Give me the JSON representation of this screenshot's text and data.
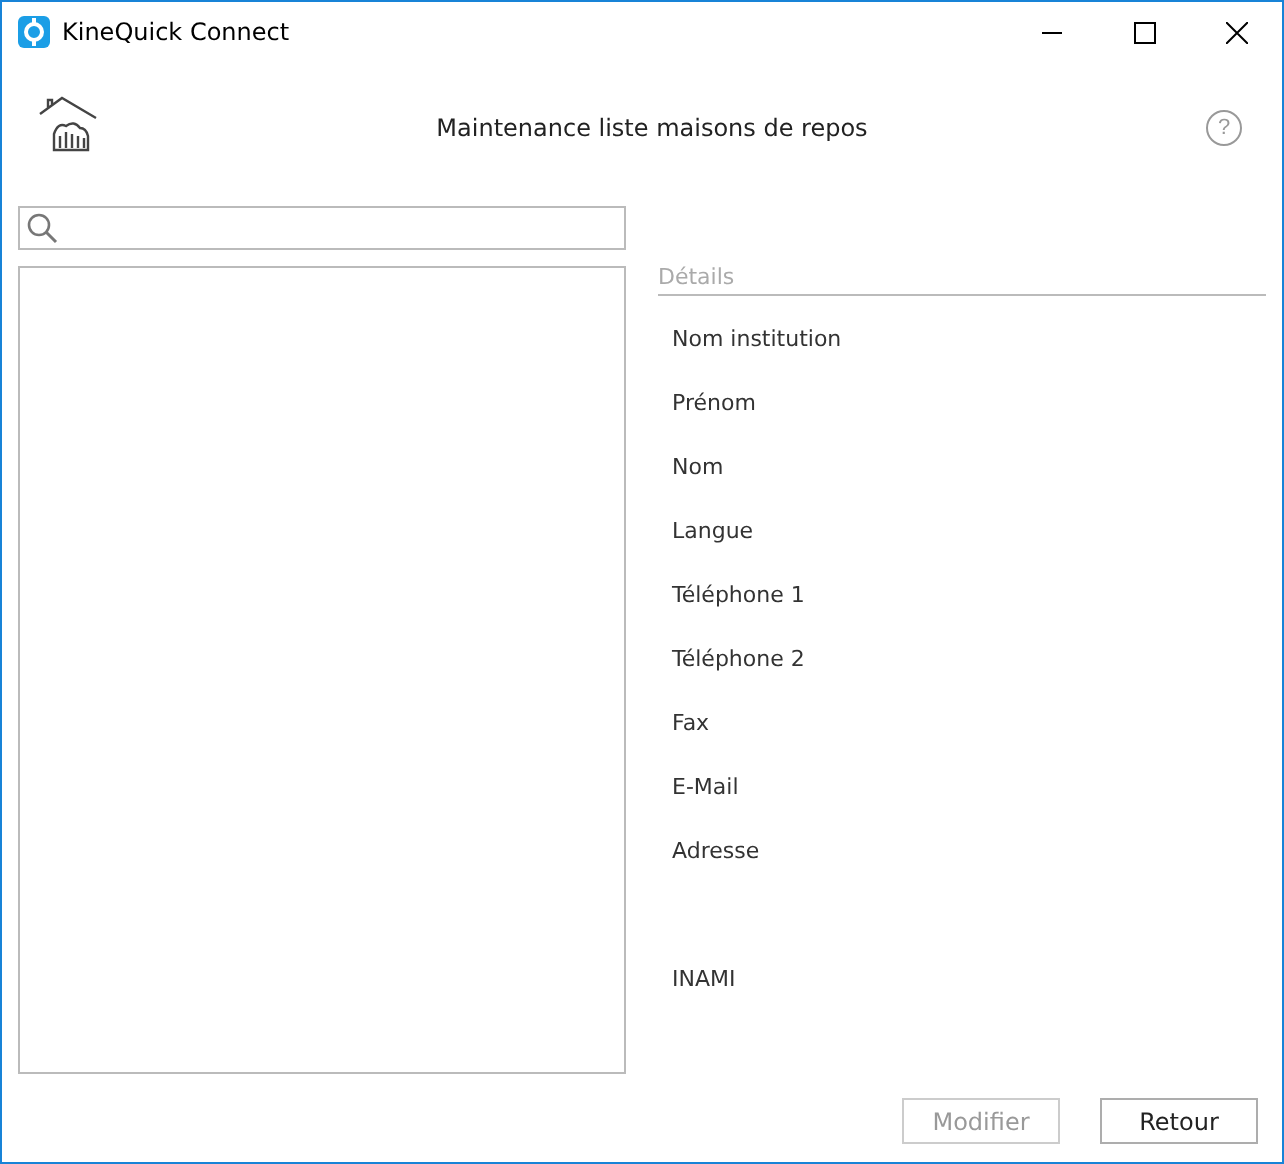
{
  "window": {
    "title": "KineQuick Connect"
  },
  "header": {
    "title": "Maintenance liste maisons de repos",
    "help": "?"
  },
  "details": {
    "title": "Détails",
    "fields": [
      {
        "label": "Nom institution",
        "kind": "line"
      },
      {
        "label": "Prénom",
        "kind": "line"
      },
      {
        "label": "Nom",
        "kind": "line"
      },
      {
        "label": "Langue",
        "kind": "line"
      },
      {
        "label": "Téléphone 1",
        "kind": "line"
      },
      {
        "label": "Téléphone 2",
        "kind": "line"
      },
      {
        "label": "Fax",
        "kind": "line"
      },
      {
        "label": "E-Mail",
        "kind": "line"
      },
      {
        "label": "Adresse",
        "kind": "multiline"
      },
      {
        "label": "INAMI",
        "kind": "line"
      }
    ]
  },
  "buttons": [
    {
      "label": "Modifier",
      "disabled": true
    },
    {
      "label": "Retour",
      "disabled": false
    }
  ]
}
